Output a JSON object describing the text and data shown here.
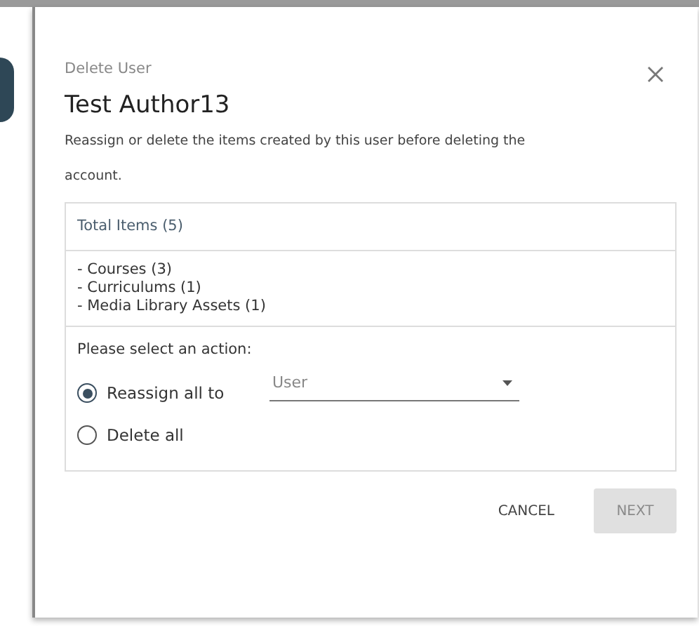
{
  "dialog": {
    "subtitle": "Delete User",
    "title": "Test Author13",
    "description": "Reassign or delete the items created by this user before deleting the account.",
    "summary": {
      "header": "Total Items (5)",
      "items": [
        "- Courses (3)",
        "- Curriculums (1)",
        "- Media Library Assets (1)"
      ]
    },
    "prompt": "Please select an action:",
    "options": [
      {
        "label": "Reassign all to",
        "selected": true,
        "kind": "select",
        "placeholder": "User"
      },
      {
        "label": "Delete all",
        "selected": false,
        "kind": "plain"
      }
    ],
    "buttons": [
      {
        "label": "CANCEL",
        "disabled": false
      },
      {
        "label": "NEXT",
        "disabled": true
      }
    ]
  }
}
